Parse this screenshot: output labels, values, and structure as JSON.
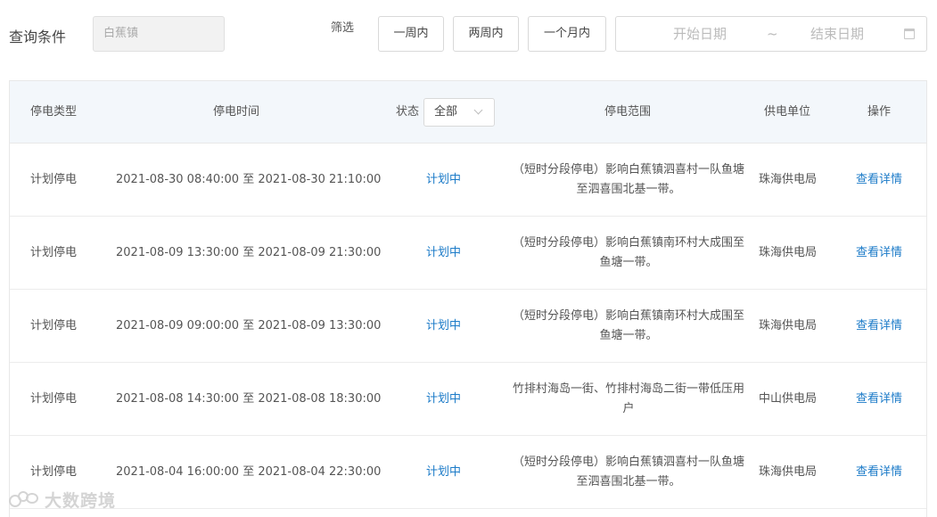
{
  "query": {
    "label": "查询条件",
    "town_value": "白蕉镇",
    "filter_label": "筛选",
    "filter_buttons": [
      "一周内",
      "两周内",
      "一个月内"
    ],
    "start_placeholder": "开始日期",
    "separator": "~",
    "end_placeholder": "结束日期"
  },
  "table": {
    "headers": {
      "type": "停电类型",
      "time": "停电时间",
      "status": "状态",
      "range": "停电范围",
      "unit": "供电单位",
      "action": "操作"
    },
    "status_filter_value": "全部",
    "rows": [
      {
        "type": "计划停电",
        "time": "2021-08-30 08:40:00 至 2021-08-30 21:10:00",
        "status": "计划中",
        "range": "（短时分段停电）影响白蕉镇泗喜村一队鱼塘至泗喜围北基一带。",
        "unit": "珠海供电局",
        "action": "查看详情"
      },
      {
        "type": "计划停电",
        "time": "2021-08-09 13:30:00 至 2021-08-09 21:30:00",
        "status": "计划中",
        "range": "（短时分段停电）影响白蕉镇南环村大成围至鱼塘一带。",
        "unit": "珠海供电局",
        "action": "查看详情"
      },
      {
        "type": "计划停电",
        "time": "2021-08-09 09:00:00 至 2021-08-09 13:30:00",
        "status": "计划中",
        "range": "（短时分段停电）影响白蕉镇南环村大成围至鱼塘一带。",
        "unit": "珠海供电局",
        "action": "查看详情"
      },
      {
        "type": "计划停电",
        "time": "2021-08-08 14:30:00 至 2021-08-08 18:30:00",
        "status": "计划中",
        "range": "竹排村海岛一街、竹排村海岛二街一带低压用户",
        "unit": "中山供电局",
        "action": "查看详情"
      },
      {
        "type": "计划停电",
        "time": "2021-08-04 16:00:00 至 2021-08-04 22:30:00",
        "status": "计划中",
        "range": "（短时分段停电）影响白蕉镇泗喜村一队鱼塘至泗喜围北基一带。",
        "unit": "珠海供电局",
        "action": "查看详情"
      }
    ]
  },
  "watermark": "大数跨境",
  "colors": {
    "link": "#1c7bc8",
    "header_bg": "#f3f7fb"
  }
}
